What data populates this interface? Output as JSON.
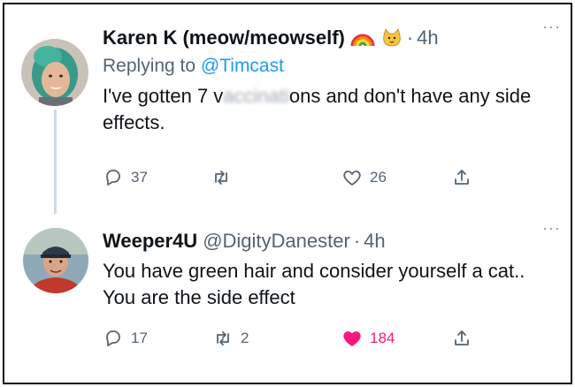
{
  "tweets": [
    {
      "name": "Karen K (meow/meowself)",
      "handle": "",
      "time": "4h",
      "reply_prefix": "Replying to",
      "reply_mention": "@Timcast",
      "text_before": "I've gotten 7 v",
      "text_blurred": "accinati",
      "text_after": "ons and don't have any side effects.",
      "emojis": [
        "rainbow-icon",
        "cat-face-icon"
      ],
      "actions": {
        "reply_count": "37",
        "retweet_count": "",
        "like_count": "26"
      }
    },
    {
      "name": "Weeper4U",
      "handle": "@DigityDanester",
      "time": "4h",
      "text": "You have green hair and consider yourself a cat.. You are the side effect",
      "actions": {
        "reply_count": "17",
        "retweet_count": "2",
        "like_count": "184",
        "liked": true
      }
    }
  ],
  "more_label": "···",
  "dot": "·",
  "colors": {
    "text": "#0f1419",
    "secondary": "#536471",
    "link": "#1d9bf0",
    "like": "#f91880",
    "thread_line": "#cfd9de",
    "frame": "#111111"
  }
}
